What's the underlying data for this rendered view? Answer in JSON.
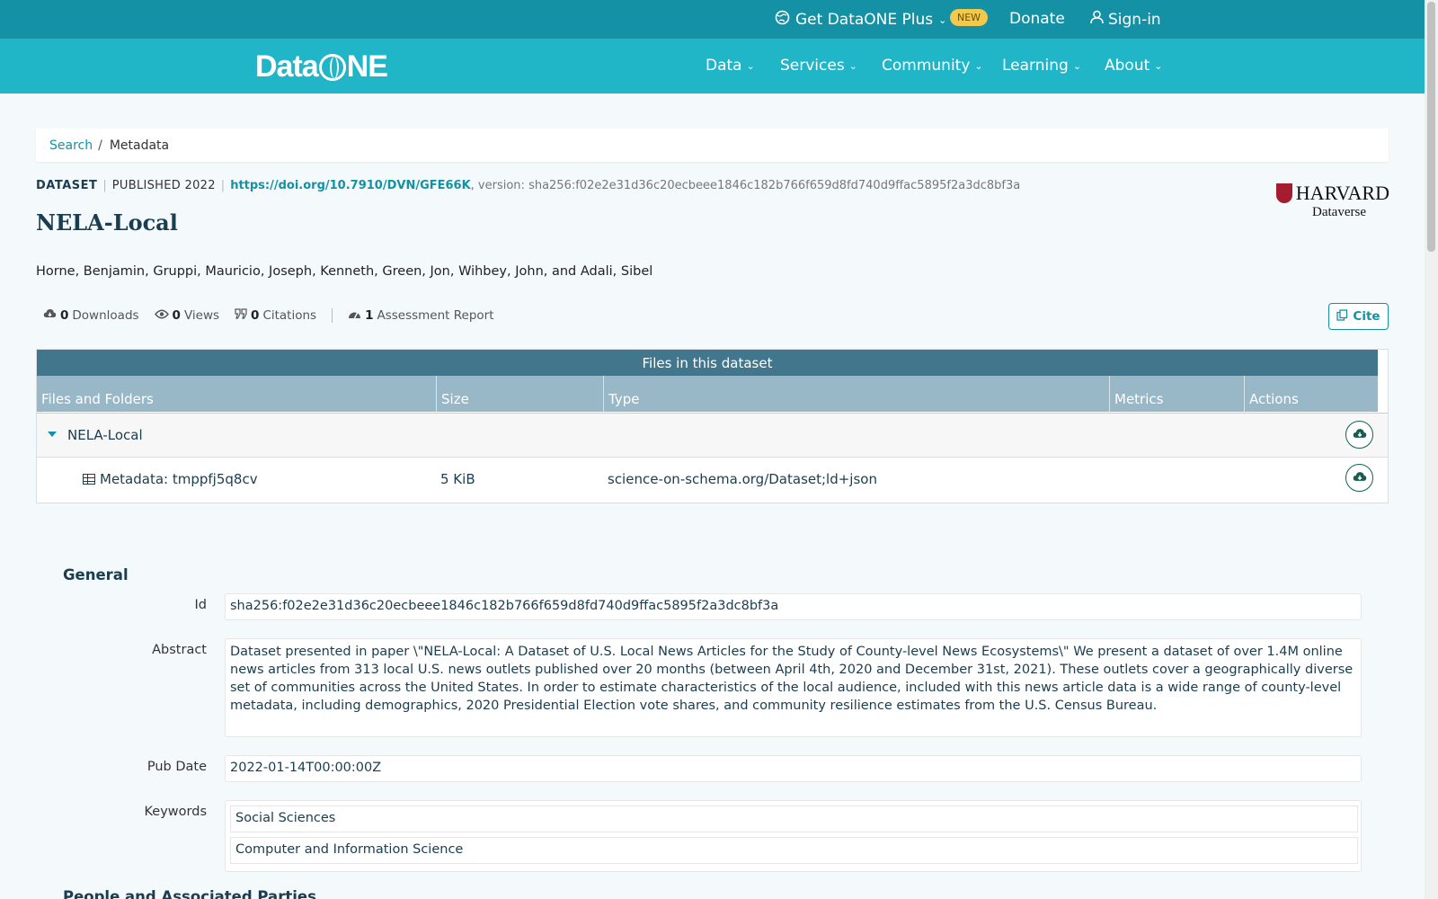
{
  "topbar": {
    "plus_label": "Get DataONE Plus",
    "new_badge": "NEW",
    "donate": "Donate",
    "signin": "Sign-in"
  },
  "nav": {
    "logo": "DataONE",
    "items": [
      {
        "label": "Data"
      },
      {
        "label": "Services"
      },
      {
        "label": "Community"
      },
      {
        "label": "Learning"
      },
      {
        "label": "About"
      }
    ]
  },
  "breadcrumb": {
    "search": "Search",
    "separator": "/",
    "current": "Metadata"
  },
  "dataset": {
    "type": "DATASET",
    "published": "PUBLISHED 2022",
    "doi": "https://doi.org/10.7910/DVN/GFE66K",
    "version": ", version: sha256:f02e2e31d36c20ecbeee1846c182b766f659d8fd740d9ffac5895f2a3dc8bf3a",
    "title": "NELA-Local",
    "authors": "Horne, Benjamin, Gruppi, Mauricio, Joseph, Kenneth, Green, Jon, Wihbey, John, and Adali, Sibel",
    "repository_logo": {
      "name": "HARVARD",
      "sub": "Dataverse"
    }
  },
  "stats": {
    "downloads_count": "0",
    "downloads_label": "Downloads",
    "views_count": "0",
    "views_label": "Views",
    "citations_count": "0",
    "citations_label": "Citations",
    "assessment_count": "1",
    "assessment_label": "Assessment Report",
    "cite_button": "Cite"
  },
  "files": {
    "heading": "Files in this dataset",
    "columns": [
      "Files and Folders",
      "Size",
      "Type",
      "Metrics",
      "Actions"
    ],
    "folder": {
      "name": "NELA-Local"
    },
    "rows": [
      {
        "name": "Metadata: tmppfj5q8cv",
        "size": "5 KiB",
        "type": "science-on-schema.org/Dataset;ld+json"
      }
    ]
  },
  "general": {
    "title": "General",
    "id_label": "Id",
    "id_value": "sha256:f02e2e31d36c20ecbeee1846c182b766f659d8fd740d9ffac5895f2a3dc8bf3a",
    "abstract_label": "Abstract",
    "abstract_value": "Dataset presented in paper \\\"NELA-Local: A Dataset of U.S. Local News Articles for the Study of County-level News Ecosystems\\\" We present a dataset of over 1.4M online news articles from 313 local U.S. news outlets published over 20 months (between April 4th, 2020 and December 31st, 2021). These outlets cover a geographically diverse set of communities across the United States. In order to estimate characteristics of the local audience, included with this news article data is a wide range of county-level metadata, including demographics, 2020 Presidential Election vote shares, and community resilience estimates from the U.S. Census Bureau.",
    "pubdate_label": "Pub Date",
    "pubdate_value": "2022-01-14T00:00:00Z",
    "keywords_label": "Keywords",
    "keywords": [
      "Social Sciences",
      "Computer and Information Science"
    ]
  },
  "next_section": "People and Associated Parties",
  "colors": {
    "topbar": "#1491a4",
    "navbar": "#21b5c8",
    "files_header": "#41768d",
    "files_columns": "#98b8c8",
    "accent": "#1491a4"
  }
}
